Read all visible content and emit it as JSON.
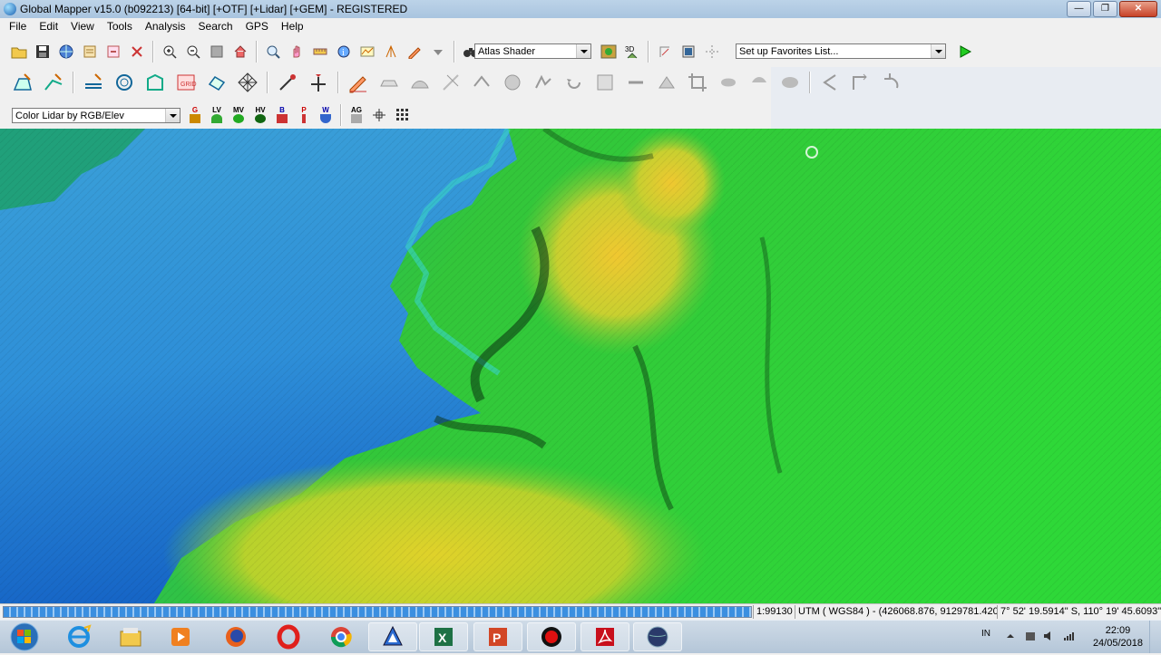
{
  "window": {
    "title": "Global Mapper v15.0 (b092213) [64-bit] [+OTF] [+Lidar] [+GEM] - REGISTERED",
    "min_label": "—",
    "max_label": "❐",
    "close_label": "✕"
  },
  "menu": [
    "File",
    "Edit",
    "View",
    "Tools",
    "Analysis",
    "Search",
    "GPS",
    "Help"
  ],
  "toolbar": {
    "shader_select": "Atlas Shader",
    "favorites_select": "Set up Favorites List...",
    "lidar_color_select": "Color Lidar by RGB/Elev",
    "lidar_class_buttons": [
      "G",
      "LV",
      "MV",
      "HV",
      "B",
      "P",
      "W",
      "AG"
    ]
  },
  "status": {
    "scale": "1:99130",
    "projection": "UTM ( WGS84 ) - (426068.876, 9129781.420 )",
    "coords": "7° 52' 19.5914\" S, 110° 19' 45.6093\" E"
  },
  "taskbar": {
    "apps": [
      "internet-explorer",
      "file-explorer",
      "media-player",
      "firefox",
      "opera",
      "chrome",
      "global-mapper",
      "excel",
      "powerpoint",
      "recorder",
      "acrobat",
      "globe"
    ],
    "language": "IN",
    "time": "22:09",
    "date": "24/05/2018"
  },
  "colors": {
    "water": "#1f7fd0",
    "lowland": "#22c23a",
    "highland": "#d8d82a",
    "accent": "#0a2a6a"
  }
}
